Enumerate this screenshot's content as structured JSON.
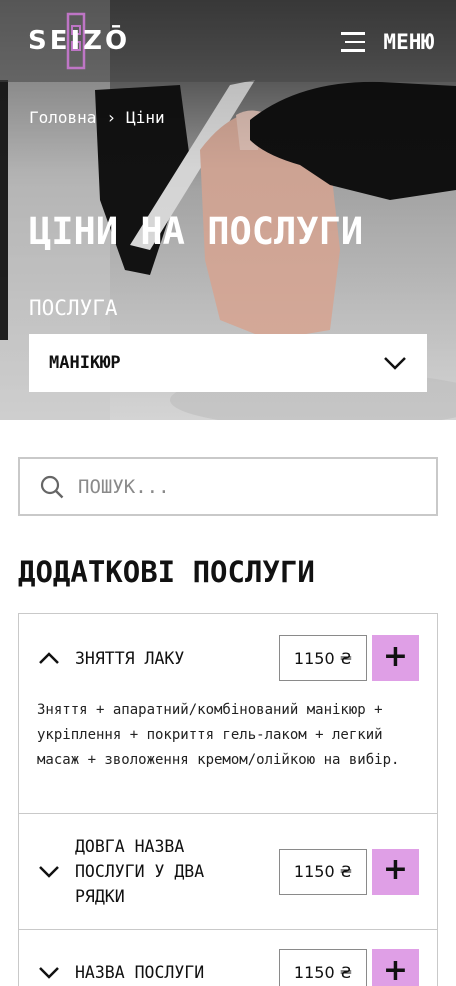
{
  "header": {
    "logo_text": "SEIZŌ",
    "menu_label": "МЕНЮ",
    "colors": {
      "accent": "#df9fe6",
      "text_on_hero": "#ffffff"
    }
  },
  "breadcrumb": {
    "home": "Головна",
    "separator": "›",
    "current": "Ціни"
  },
  "hero": {
    "title": "ЦІНИ НА ПОСЛУГИ",
    "service_label": "ПОСЛУГА",
    "selected_service": "МАНІКЮР"
  },
  "search": {
    "placeholder": "ПОШУК..."
  },
  "section": {
    "title": "ДОДАТКОВІ ПОСЛУГИ"
  },
  "services": [
    {
      "name": "ЗНЯТТЯ ЛАКУ",
      "price": "1150 ₴",
      "expanded": true,
      "description": "Зняття + апаратний/комбінований манікюр + укріплення + покриття гель-лаком + легкий масаж + зволоження кремом/олійкою на вибір."
    },
    {
      "name": "ДОВГА НАЗВА ПОСЛУГИ У ДВА РЯДКИ",
      "price": "1150 ₴",
      "expanded": false
    },
    {
      "name": "НАЗВА ПОСЛУГИ",
      "price": "1150 ₴",
      "expanded": false
    }
  ],
  "icons": {
    "add": "+",
    "expanded": "chevron-up-icon",
    "collapsed": "chevron-down-icon"
  }
}
